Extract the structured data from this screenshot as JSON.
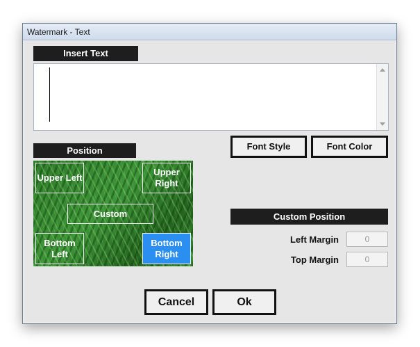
{
  "window": {
    "title": "Watermark - Text"
  },
  "insert_text": {
    "header": "Insert Text",
    "value": ""
  },
  "position": {
    "header": "Position",
    "buttons": {
      "upper_left": "Upper Left",
      "upper_right": "Upper Right",
      "custom": "Custom",
      "bottom_left": "Bottom Left",
      "bottom_right": "Bottom Right"
    },
    "selected": "Bottom Right"
  },
  "font": {
    "style_label": "Font Style",
    "color_label": "Font Color"
  },
  "custom_position": {
    "header": "Custom Position",
    "left_margin_label": "Left Margin",
    "left_margin_value": "0",
    "top_margin_label": "Top Margin",
    "top_margin_value": "0"
  },
  "actions": {
    "cancel_label": "Cancel",
    "ok_label": "Ok"
  },
  "colors": {
    "header_bg": "#1e1e1e",
    "selected_position": "#2a8ff0",
    "title_bar": "#dbe5f1"
  }
}
